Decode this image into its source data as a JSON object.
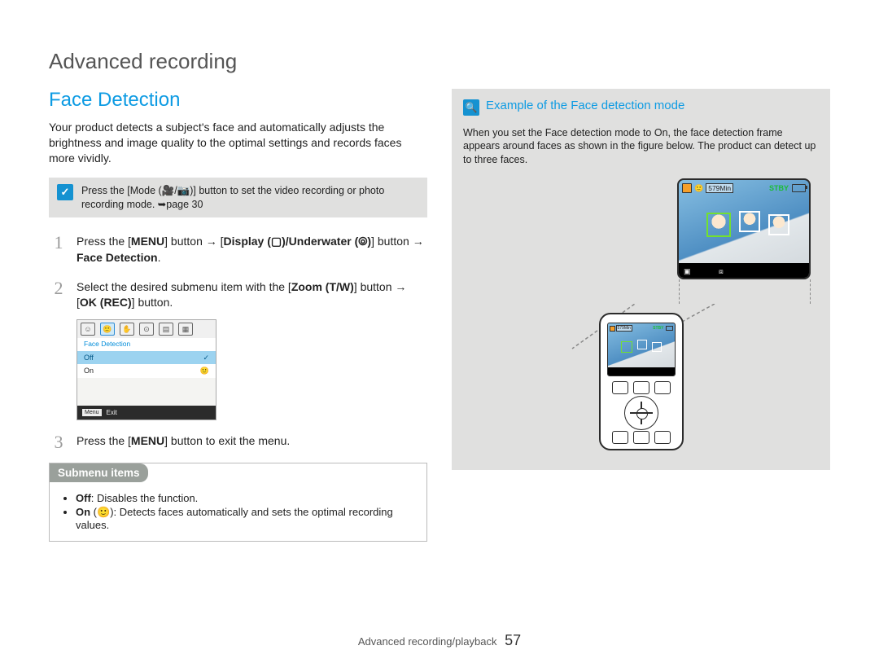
{
  "chapter_title": "Advanced recording",
  "section_title": "Face Detection",
  "intro": "Your product detects a subject's face and automatically adjusts the brightness and image quality to the optimal settings and records faces more vividly.",
  "precondition_note": "Press the [Mode (🎥/📷)] button to set the video recording or photo recording mode. ➥page 30",
  "steps": {
    "s1": {
      "pre": "Press the [",
      "b1": "MENU",
      "mid1": "] button → [",
      "b2": "Display (▢)/Underwater (⦾)",
      "mid2": "] button → ",
      "b3": "Face Detection",
      "post": "."
    },
    "s2": {
      "pre": "Select the desired submenu item with the [",
      "b1": "Zoom (T/W)",
      "mid1": "] button → [",
      "b2": "OK (REC)",
      "post": "] button."
    },
    "s3": {
      "pre": "Press the [",
      "b1": "MENU",
      "post": "] button to exit the menu."
    }
  },
  "lcd": {
    "title": "Face Detection",
    "off": "Off",
    "on": "On",
    "exit_icon": "Menu",
    "exit": "Exit"
  },
  "submenu": {
    "header": "Submenu items",
    "off_label": "Off",
    "off_desc": ": Disables the function.",
    "on_label": "On",
    "on_desc": " (🙂): Detects faces automatically and sets the optimal recording values."
  },
  "example": {
    "title": "Example of the Face detection mode",
    "body": "When you set the Face detection mode to On, the face detection frame appears around faces as shown in the figure below. The product can detect up to three faces.",
    "monitor": {
      "time": "579Min",
      "stby": "STBY"
    }
  },
  "footer": {
    "section": "Advanced recording/playback",
    "page": "57"
  }
}
